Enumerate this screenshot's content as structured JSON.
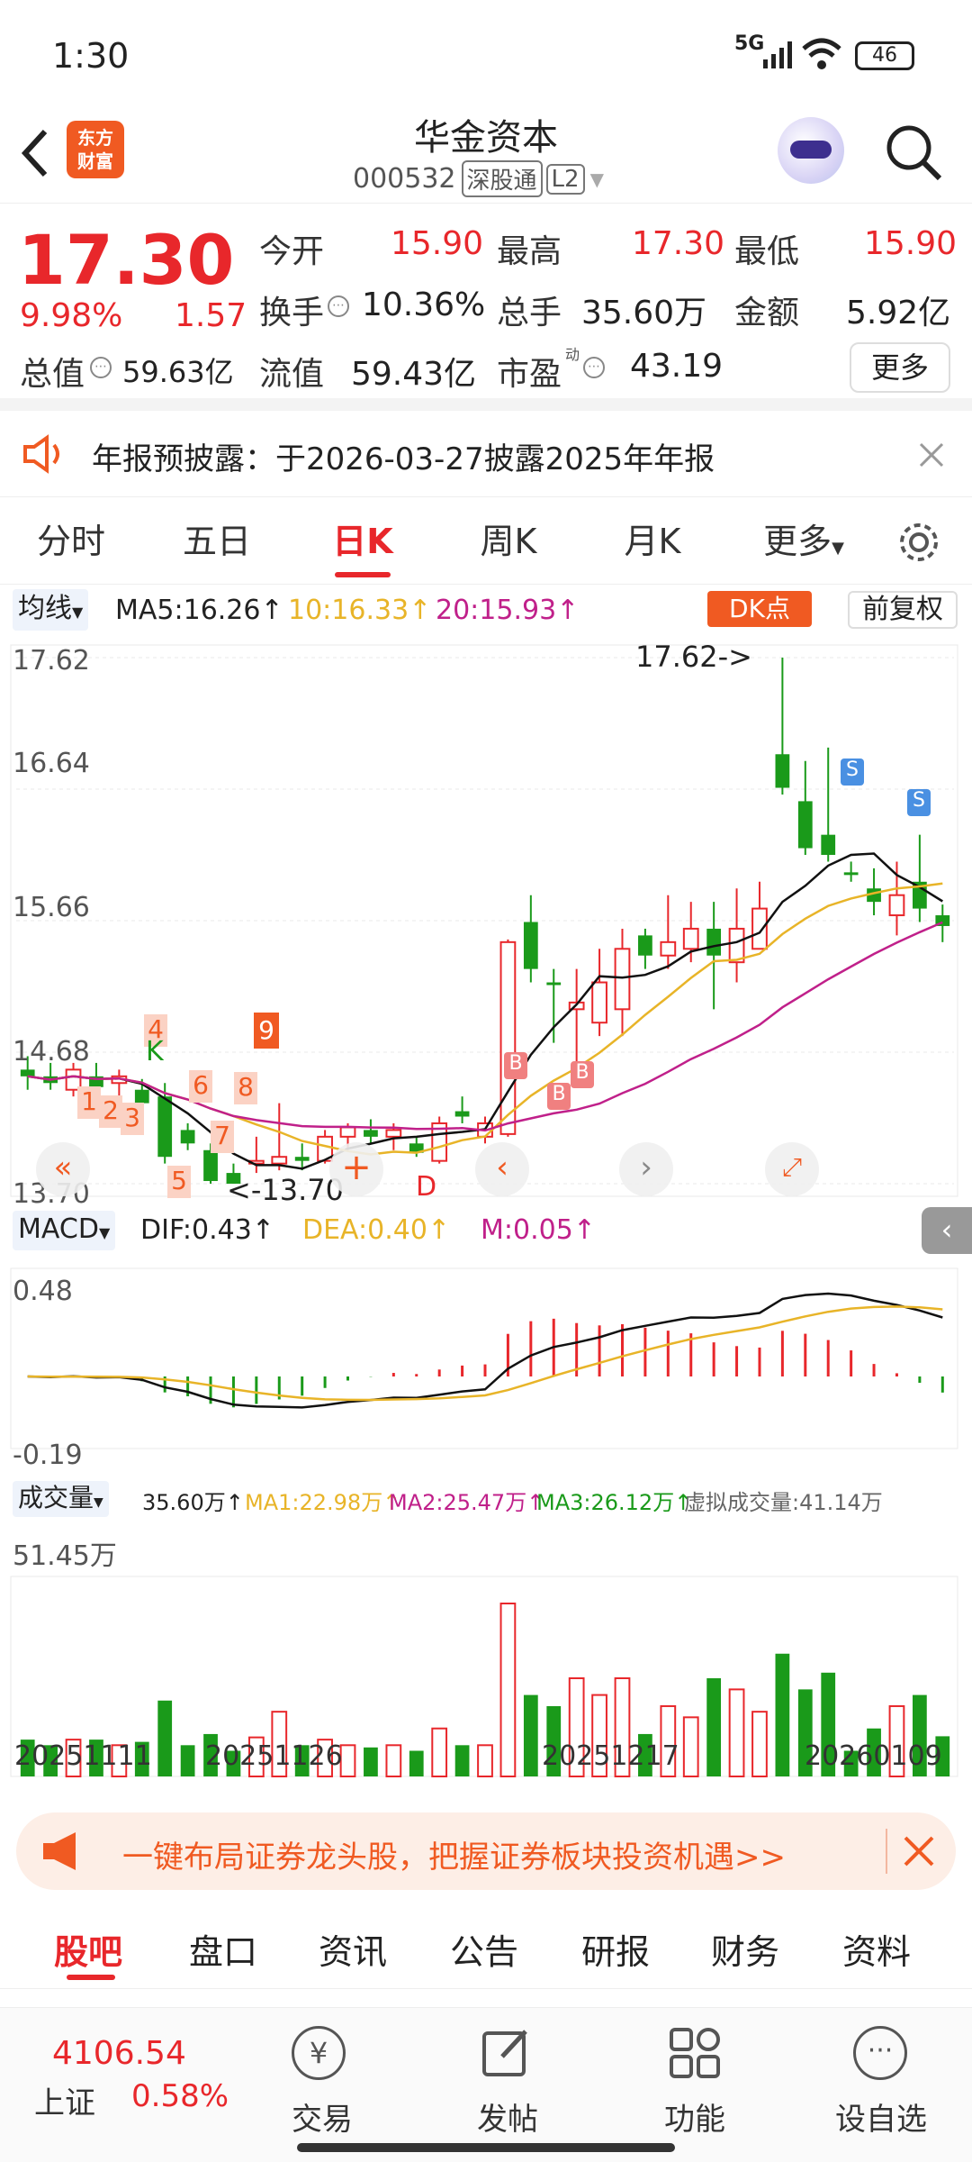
{
  "status_bar": {
    "time": "1:30",
    "network": "5G",
    "battery": "46"
  },
  "header": {
    "logo_line1": "东方",
    "logo_line2": "财富",
    "stock_name": "华金资本",
    "stock_code": "000532",
    "badge_connect": "深股通",
    "badge_level": "L2"
  },
  "quote": {
    "price": "17.30",
    "change_pct": "9.98%",
    "change_amt": "1.57",
    "open_label": "今开",
    "open": "15.90",
    "high_label": "最高",
    "high": "17.30",
    "low_label": "最低",
    "low": "15.90",
    "turnover_label": "换手",
    "turnover": "10.36%",
    "volume_label": "总手",
    "volume": "35.60万",
    "amount_label": "金额",
    "amount": "5.92亿",
    "mktcap_label": "总值",
    "mktcap": "59.63亿",
    "float_label": "流值",
    "float_cap": "59.43亿",
    "pe_label": "市盈",
    "pe_sup": "动",
    "pe": "43.19",
    "more_label": "更多"
  },
  "notice": {
    "text": "年报预披露：于2026-03-27披露2025年年报"
  },
  "chart_tabs": [
    "分时",
    "五日",
    "日K",
    "周K",
    "月K",
    "更多"
  ],
  "chart_tabs_active": 2,
  "ma_bar": {
    "selector": "均线",
    "ma5": "MA5:16.26↑",
    "ma10": "10:16.33↑",
    "ma20": "20:15.93↑",
    "dk_label": "DK点",
    "adjust_label": "前复权"
  },
  "main_chart_labels": {
    "y_top": "17.62",
    "y_2": "16.64",
    "y_3": "15.66",
    "y_4": "14.68",
    "y_bottom": "13.70",
    "max_marker": "17.62->",
    "min_marker": "<-13.70",
    "num_markers": [
      "1",
      "2",
      "3",
      "4",
      "5",
      "6",
      "7",
      "8",
      "9"
    ],
    "k_marker": "K",
    "d_marker": "D",
    "b_marker": "B",
    "s_marker": "S"
  },
  "macd": {
    "selector": "MACD",
    "dif": "DIF:0.43↑",
    "dea": "DEA:0.40↑",
    "m": "M:0.05↑",
    "y_top": "0.48",
    "y_bottom": "-0.19"
  },
  "vol": {
    "selector": "成交量",
    "cur": "35.60万↑",
    "ma1": "MA1:22.98万↑",
    "ma2": "MA2:25.47万↑",
    "ma3": "MA3:26.12万↑",
    "virtual": "虚拟成交量:41.14万",
    "y_top": "51.45万"
  },
  "dates": [
    "20251111",
    "20251126",
    "20251217",
    "20260109"
  ],
  "colors": {
    "up": "#e8272b",
    "down": "#1a9a1a",
    "ma5": "#111111",
    "ma10": "#e8b428",
    "ma20": "#c0208a",
    "accent": "#f05a22"
  },
  "chart_data": {
    "type": "candlestick",
    "x": [
      "d1",
      "d2",
      "d3",
      "d4",
      "d5",
      "d6",
      "d7",
      "d8",
      "d9",
      "d10",
      "d11",
      "d12",
      "d13",
      "d14",
      "d15",
      "d16",
      "d17",
      "d18",
      "d19",
      "d20",
      "d21",
      "d22",
      "d23",
      "d24",
      "d25",
      "d26",
      "d27",
      "d28",
      "d29",
      "d30",
      "d31",
      "d32",
      "d33",
      "d34",
      "d35",
      "d36",
      "d37",
      "d38",
      "d39",
      "d40",
      "d41"
    ],
    "candles": [
      {
        "o": 14.55,
        "c": 14.5,
        "h": 14.65,
        "l": 14.4
      },
      {
        "o": 14.5,
        "c": 14.45,
        "h": 14.6,
        "l": 14.4
      },
      {
        "o": 14.4,
        "c": 14.55,
        "h": 14.6,
        "l": 14.35
      },
      {
        "o": 14.5,
        "c": 14.42,
        "h": 14.6,
        "l": 14.35
      },
      {
        "o": 14.45,
        "c": 14.5,
        "h": 14.55,
        "l": 14.35
      },
      {
        "o": 14.4,
        "c": 14.3,
        "h": 14.48,
        "l": 14.25
      },
      {
        "o": 14.35,
        "c": 13.9,
        "h": 14.45,
        "l": 13.85
      },
      {
        "o": 14.1,
        "c": 14.0,
        "h": 14.15,
        "l": 13.95
      },
      {
        "o": 13.95,
        "c": 13.72,
        "h": 14.0,
        "l": 13.7
      },
      {
        "o": 13.78,
        "c": 13.7,
        "h": 13.85,
        "l": 13.7
      },
      {
        "o": 13.85,
        "c": 13.87,
        "h": 14.05,
        "l": 13.78
      },
      {
        "o": 13.85,
        "c": 13.9,
        "h": 14.3,
        "l": 13.8
      },
      {
        "o": 13.9,
        "c": 13.87,
        "h": 14.0,
        "l": 13.8
      },
      {
        "o": 13.87,
        "c": 14.05,
        "h": 14.1,
        "l": 13.85
      },
      {
        "o": 14.05,
        "c": 14.12,
        "h": 14.15,
        "l": 13.95
      },
      {
        "o": 14.1,
        "c": 14.05,
        "h": 14.18,
        "l": 14.0
      },
      {
        "o": 14.05,
        "c": 14.1,
        "h": 14.15,
        "l": 13.95
      },
      {
        "o": 14.0,
        "c": 13.93,
        "h": 14.05,
        "l": 13.9
      },
      {
        "o": 13.87,
        "c": 14.15,
        "h": 14.2,
        "l": 13.85
      },
      {
        "o": 14.24,
        "c": 14.2,
        "h": 14.35,
        "l": 14.15
      },
      {
        "o": 14.05,
        "c": 14.15,
        "h": 14.2,
        "l": 14.0
      },
      {
        "o": 14.07,
        "c": 15.5,
        "h": 15.52,
        "l": 14.05
      },
      {
        "o": 15.65,
        "c": 15.3,
        "h": 15.85,
        "l": 15.2
      },
      {
        "o": 15.2,
        "c": 15.18,
        "h": 15.3,
        "l": 14.75
      },
      {
        "o": 15.0,
        "c": 15.05,
        "h": 15.3,
        "l": 14.5
      },
      {
        "o": 14.9,
        "c": 15.2,
        "h": 15.45,
        "l": 14.8
      },
      {
        "o": 15.0,
        "c": 15.45,
        "h": 15.6,
        "l": 14.8
      },
      {
        "o": 15.55,
        "c": 15.4,
        "h": 15.6,
        "l": 15.3
      },
      {
        "o": 15.4,
        "c": 15.5,
        "h": 15.85,
        "l": 15.3
      },
      {
        "o": 15.45,
        "c": 15.6,
        "h": 15.8,
        "l": 15.35
      },
      {
        "o": 15.6,
        "c": 15.4,
        "h": 15.8,
        "l": 15.0
      },
      {
        "o": 15.35,
        "c": 15.6,
        "h": 15.9,
        "l": 15.2
      },
      {
        "o": 15.45,
        "c": 15.75,
        "h": 15.95,
        "l": 15.45
      },
      {
        "o": 16.9,
        "c": 16.65,
        "h": 17.62,
        "l": 16.6
      },
      {
        "o": 16.55,
        "c": 16.2,
        "h": 16.85,
        "l": 16.15
      },
      {
        "o": 16.3,
        "c": 16.15,
        "h": 16.95,
        "l": 16.1
      },
      {
        "o": 16.02,
        "c": 16.0,
        "h": 16.1,
        "l": 15.95
      },
      {
        "o": 15.9,
        "c": 15.8,
        "h": 16.05,
        "l": 15.7
      },
      {
        "o": 15.7,
        "c": 15.85,
        "h": 16.1,
        "l": 15.55
      },
      {
        "o": 15.95,
        "c": 15.75,
        "h": 16.3,
        "l": 15.65
      },
      {
        "o": 15.7,
        "c": 15.62,
        "h": 15.78,
        "l": 15.5
      }
    ],
    "ylim": [
      13.7,
      17.62
    ]
  }
}
